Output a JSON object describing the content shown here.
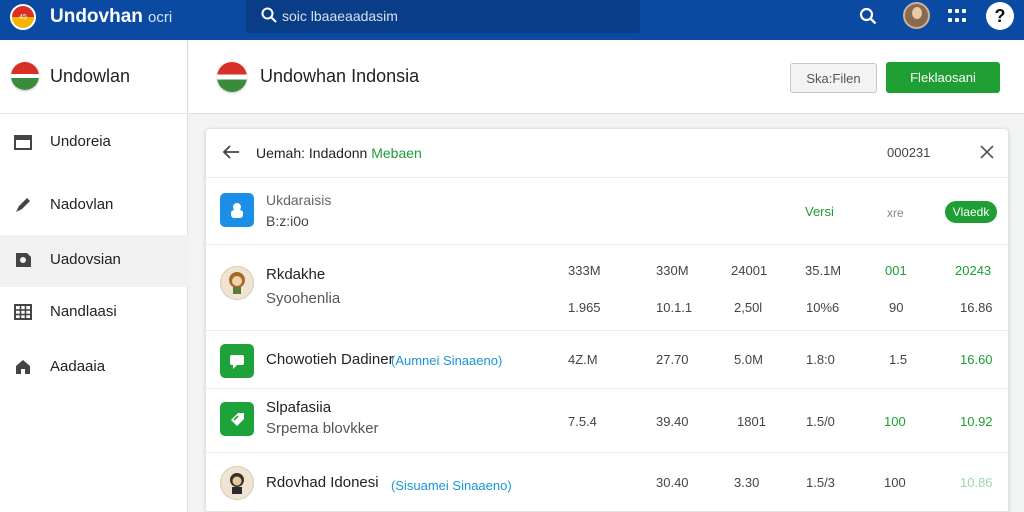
{
  "topbar": {
    "logo_text": "45",
    "title": "Undovhan",
    "subtitle": "ocri",
    "search": {
      "placeholder": "soic lbaaeaadasim"
    }
  },
  "sidebar": {
    "title": "Undowlan",
    "items": [
      {
        "label": "Undoreia",
        "icon": "window-icon"
      },
      {
        "label": "Nadovlan",
        "icon": "pen-icon"
      },
      {
        "label": "Uadovsian",
        "icon": "gear-icon",
        "active": true
      },
      {
        "label": "Nandlaasi",
        "icon": "table-icon"
      },
      {
        "label": "Aadaaia",
        "icon": "home-icon"
      }
    ]
  },
  "header": {
    "title": "Undowhan Indonsia",
    "secondary_button": "Ska:Filen",
    "primary_button": "Fleklaosani"
  },
  "card": {
    "title_main": "Uemah: Indadonn",
    "title_accent": "Mebaen",
    "count": "000231",
    "head_row": {
      "name": "Ukdaraisis",
      "sub": "B:z:i0o",
      "col_versi": "Versi",
      "col_xre": "xre",
      "pill": "Vlaedk"
    },
    "rows": [
      {
        "name": "Rkdakhe",
        "sub": "Syoohenlia",
        "icon": "character-avatar-icon",
        "line1": [
          "333M",
          "330M",
          "24001",
          "35.1M",
          "001",
          "20243"
        ],
        "line2": [
          "1.965",
          "10.1.1",
          "2,50l",
          "10%6",
          "90",
          "16.86"
        ]
      },
      {
        "name": "Chowotieh Dadiner",
        "tag": "(Aumnei Sinaaeno)",
        "icon": "chat-icon",
        "line1": [
          "4Z.M",
          "27.70",
          "5.0M",
          "1.8:0",
          "1.5",
          "16.60"
        ]
      },
      {
        "name": "Slpafasiia",
        "sub": "Srpema blovkker",
        "icon": "tag-icon",
        "line1": [
          "7.5.4",
          "39.40",
          "1801",
          "1.5/0",
          "100",
          "10.92"
        ]
      },
      {
        "name": "Rdovhad Idonesi",
        "tag": "(Sisuamei Sinaaeno)",
        "icon": "character-avatar-icon",
        "line1": [
          "30.40",
          "3.30",
          "1.5/3",
          "100",
          "10.86"
        ]
      }
    ]
  }
}
